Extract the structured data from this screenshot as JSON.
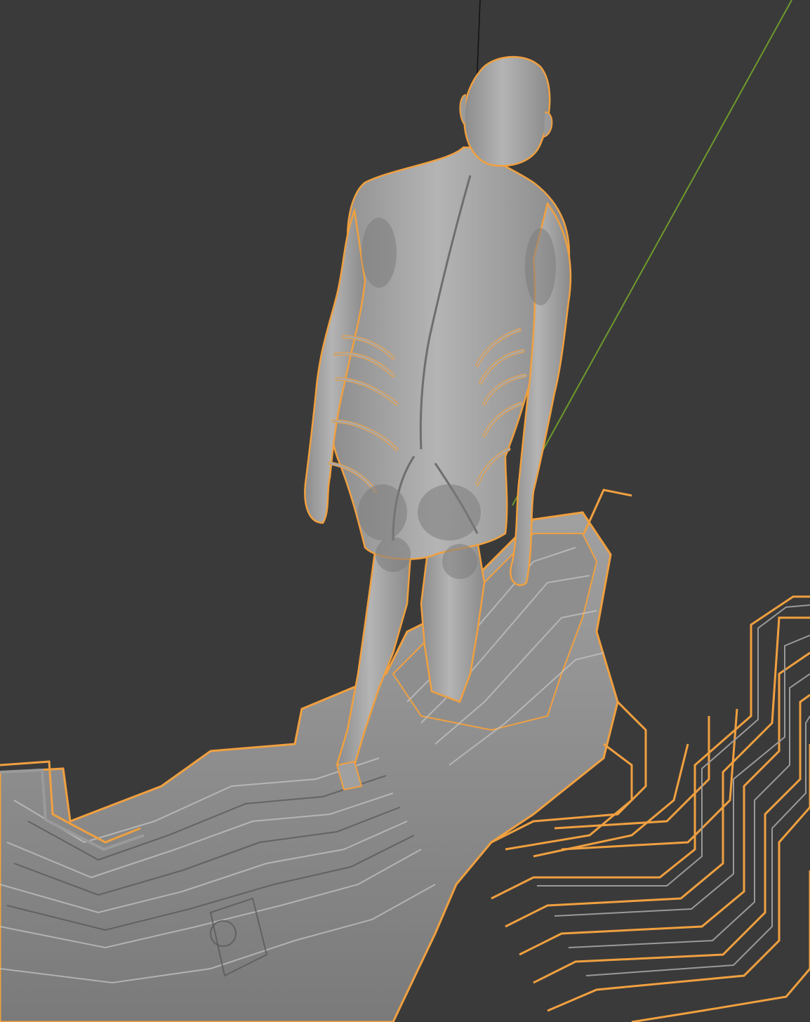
{
  "viewport": {
    "background": "#3a3a3a",
    "selection_outline_color": "#f0a040",
    "mesh_color": "#9a9a9a",
    "y_axis_color": "#6e9a2c",
    "z_axis_color": "#111111"
  },
  "scene": {
    "objects": [
      {
        "name": "human-figure",
        "selected": true
      },
      {
        "name": "circuit-floor-mesh",
        "selected": true
      }
    ]
  }
}
